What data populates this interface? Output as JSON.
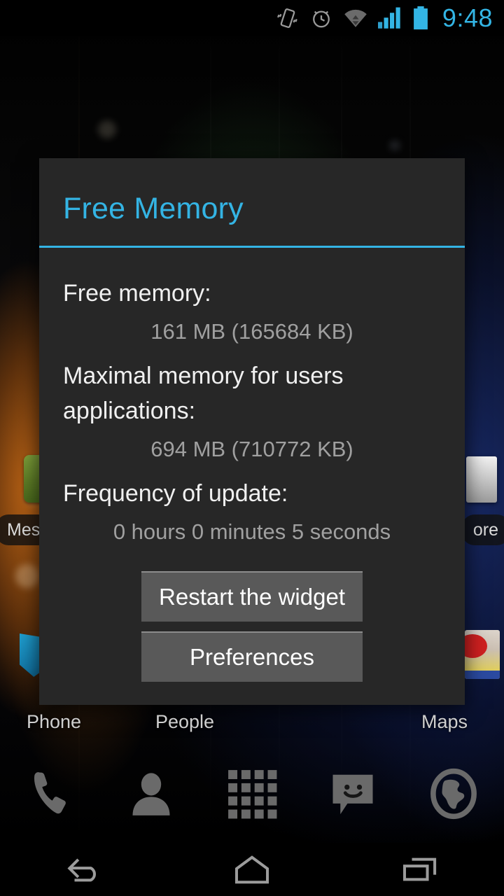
{
  "status_bar": {
    "icons": [
      {
        "name": "vibrate-icon",
        "label": "Vibrate"
      },
      {
        "name": "alarm-icon",
        "label": "Alarm set"
      },
      {
        "name": "wifi-icon",
        "label": "Wi-Fi"
      },
      {
        "name": "signal-icon",
        "label": "Cellular signal"
      },
      {
        "name": "battery-icon",
        "label": "Battery"
      }
    ],
    "time": "9:48",
    "accent_color": "#33b5e5"
  },
  "dialog": {
    "title": "Free Memory",
    "accent_color": "#34b4e4",
    "background_color": "#272727",
    "rows": [
      {
        "label": "Free memory:",
        "value": "161 MB (165684 KB)"
      },
      {
        "label": "Maximal memory for users applications:",
        "value": "694 MB (710772 KB)"
      },
      {
        "label": "Frequency of update:",
        "value": "0 hours 0 minutes 5 seconds"
      }
    ],
    "buttons": [
      {
        "label": "Restart the widget",
        "name": "restart-widget-button"
      },
      {
        "label": "Preferences",
        "name": "preferences-button"
      }
    ]
  },
  "home_screen": {
    "folder_pills": [
      {
        "label": "Mes",
        "name": "messaging-shortcut-label"
      },
      {
        "label": "ore",
        "name": "play-store-shortcut-label"
      }
    ],
    "app_labels": [
      {
        "label": "Phone",
        "name": "app-label-phone"
      },
      {
        "label": "People",
        "name": "app-label-people"
      },
      {
        "label": "Maps",
        "name": "app-label-maps"
      }
    ],
    "dock": [
      {
        "name": "dock-phone-icon",
        "label": "Phone"
      },
      {
        "name": "dock-people-icon",
        "label": "People"
      },
      {
        "name": "dock-app-drawer-icon",
        "label": "All apps"
      },
      {
        "name": "dock-messaging-icon",
        "label": "Messaging"
      },
      {
        "name": "dock-browser-icon",
        "label": "Browser"
      }
    ]
  },
  "nav_bar": {
    "buttons": [
      {
        "name": "nav-back-button",
        "label": "Back"
      },
      {
        "name": "nav-home-button",
        "label": "Home"
      },
      {
        "name": "nav-recents-button",
        "label": "Recent apps"
      }
    ]
  }
}
